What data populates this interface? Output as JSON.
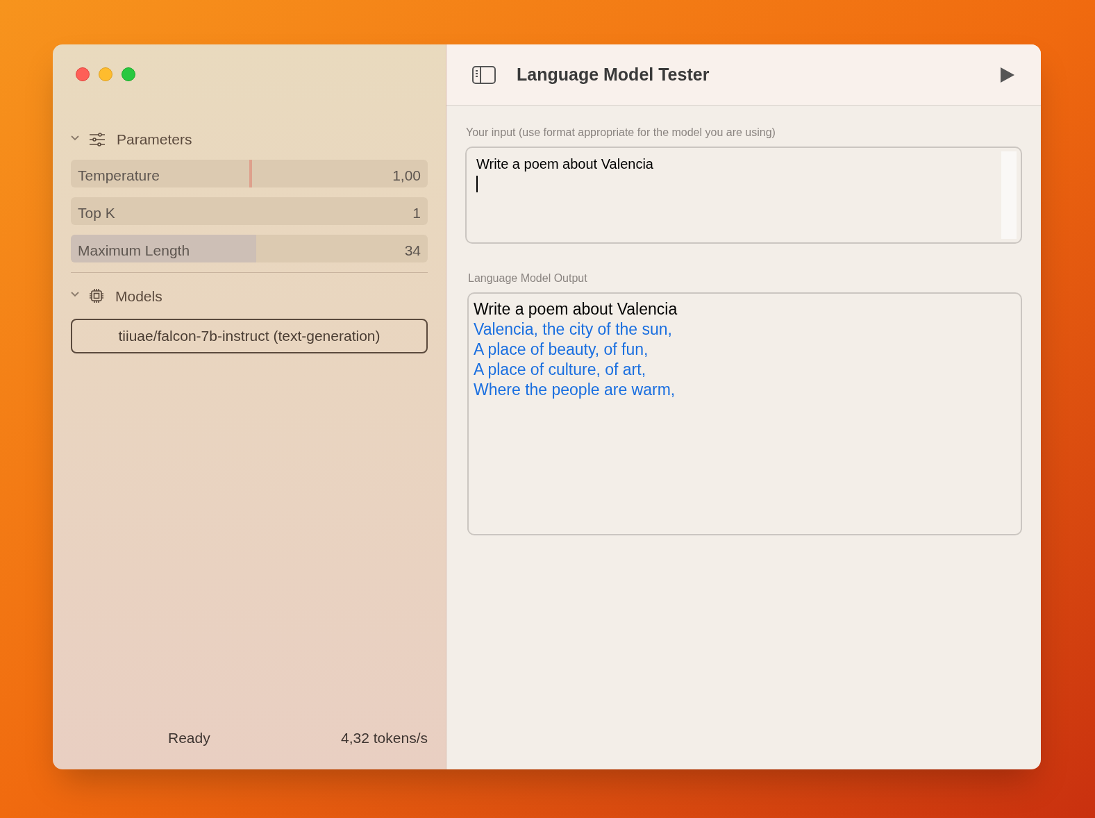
{
  "window": {
    "title": "Language Model Tester"
  },
  "sidebar": {
    "sections": [
      {
        "title": "Parameters",
        "expanded": true
      },
      {
        "title": "Models",
        "expanded": true
      }
    ],
    "parameters": [
      {
        "label": "Temperature",
        "value": "1,00",
        "kind": "marker",
        "level": 0.5
      },
      {
        "label": "Top K",
        "value": "1",
        "kind": "fill",
        "level": 0
      },
      {
        "label": "Maximum Length",
        "value": "34",
        "kind": "fill",
        "level": 0.52
      }
    ],
    "model": "tiiuae/falcon-7b-instruct (text-generation)",
    "status": "Ready",
    "speed": "4,32 tokens/s"
  },
  "input": {
    "label": "Your input (use format appropriate for the model you are using)",
    "value": "Write a poem about Valencia"
  },
  "output": {
    "label": "Language Model Output",
    "prompt": "Write a poem about Valencia",
    "generated": [
      "Valencia, the city of the sun,",
      "A place of beauty, of fun,",
      "A place of culture, of art,",
      "Where the people are warm,"
    ]
  }
}
